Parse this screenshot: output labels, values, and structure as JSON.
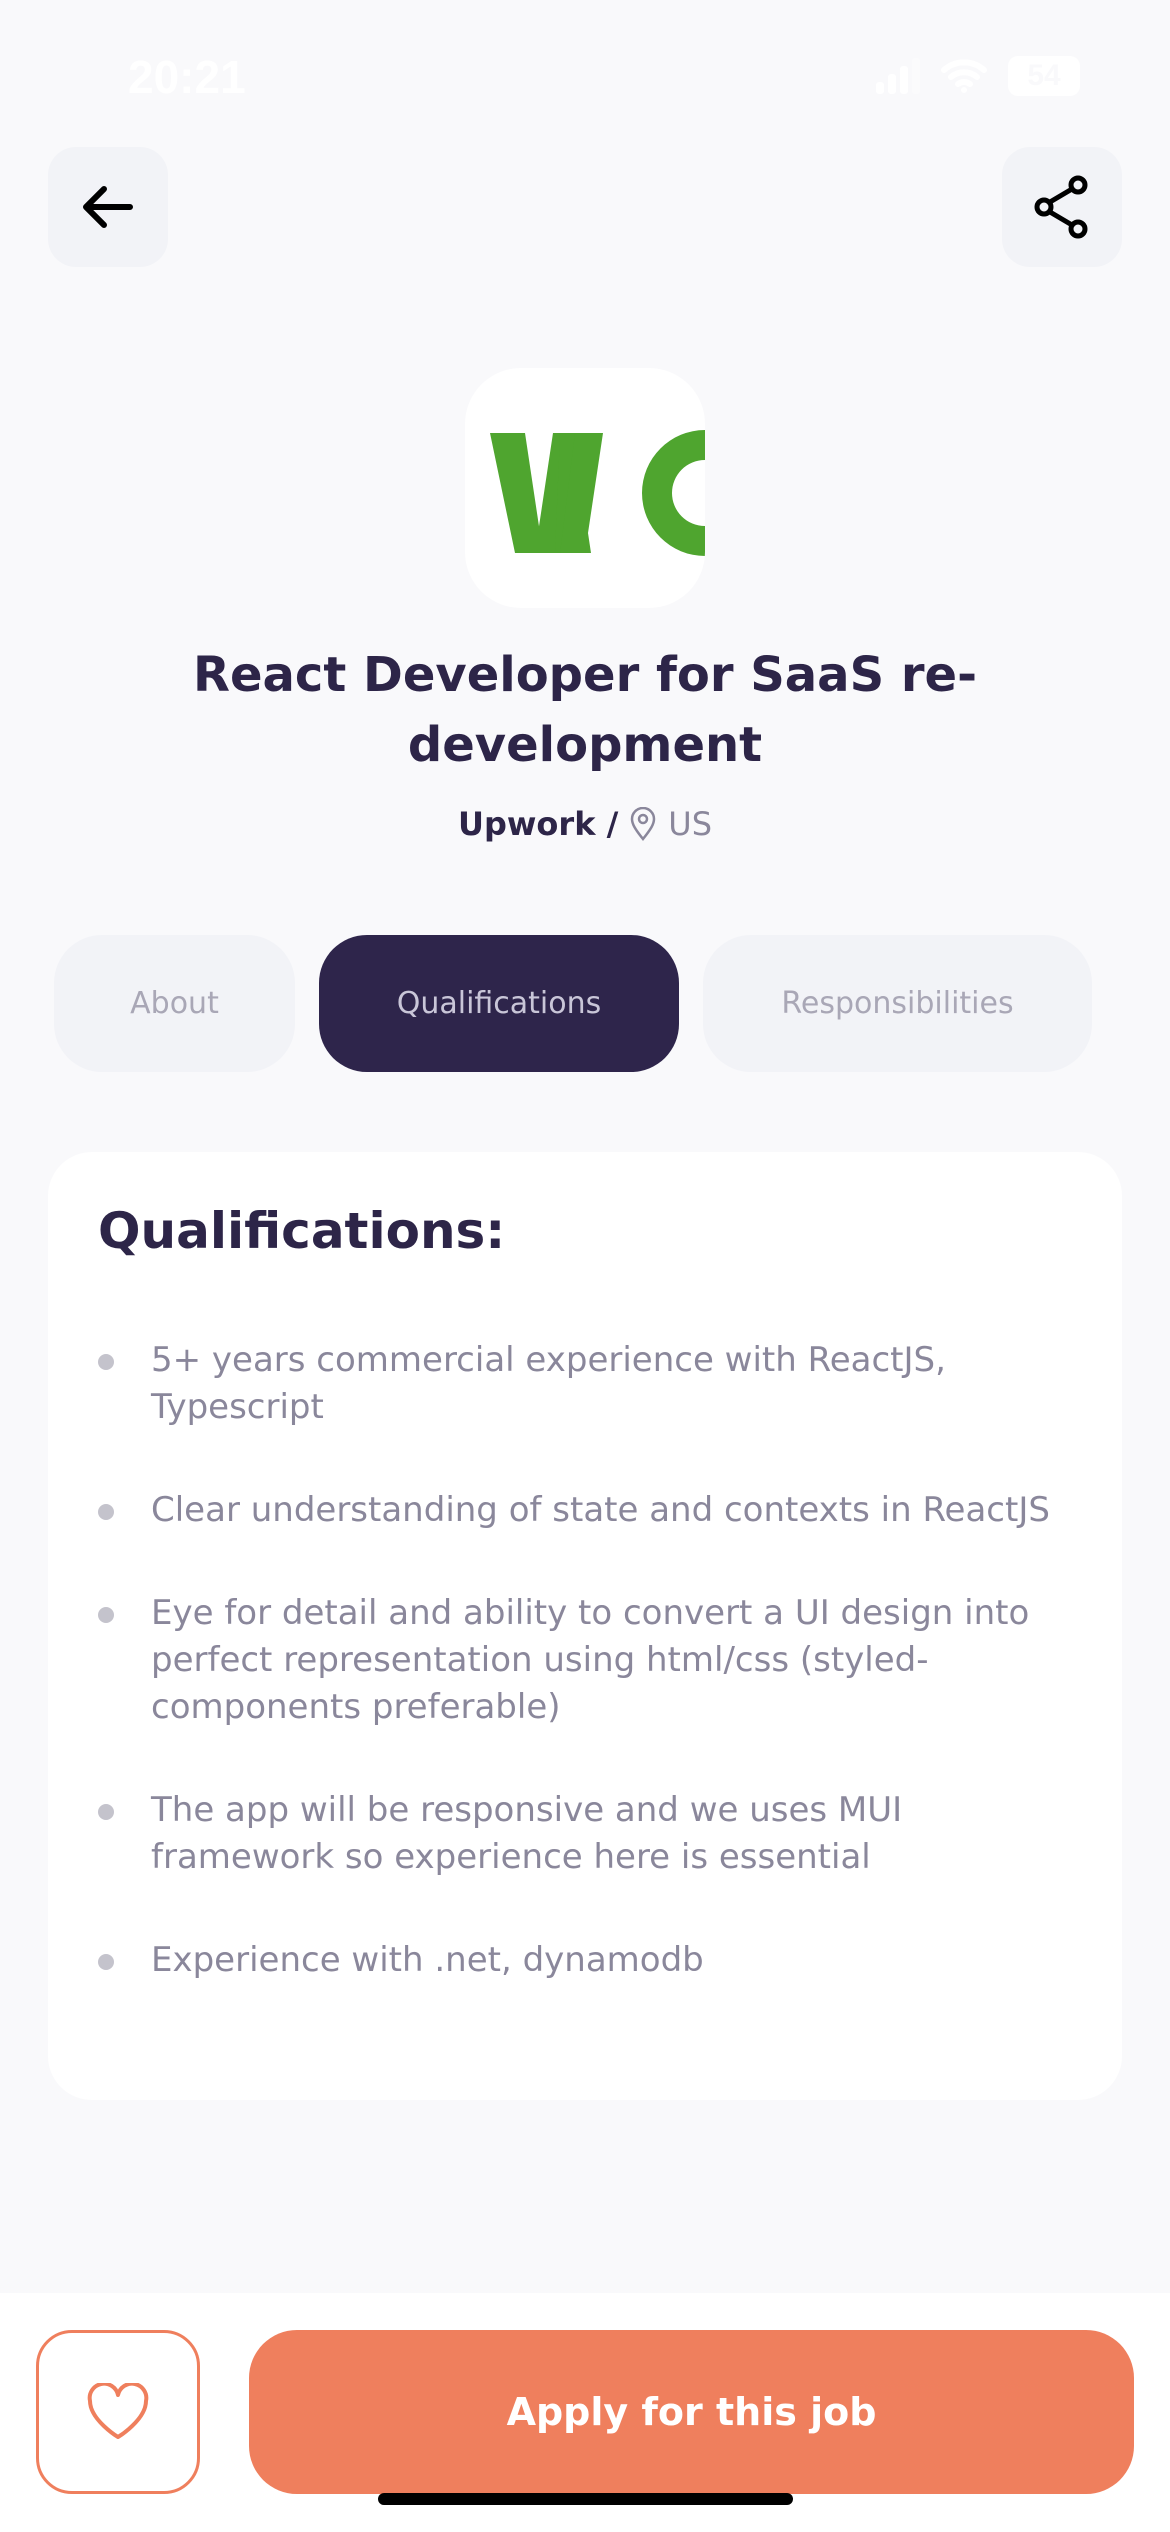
{
  "status_bar": {
    "time": "20:21",
    "battery": "54"
  },
  "header": {
    "back_icon": "arrow-left-icon",
    "share_icon": "share-icon"
  },
  "job": {
    "logo_text": "WC",
    "logo_color": "#4fa52f",
    "title": "React Developer for SaaS re-development",
    "company": "Upwork /",
    "location": "US"
  },
  "tabs": [
    {
      "label": "About",
      "active": false
    },
    {
      "label": "Qualifications",
      "active": true
    },
    {
      "label": "Responsibilities",
      "active": false
    }
  ],
  "qualifications": {
    "heading": "Qualifications:",
    "items": [
      "5+ years commercial experience with ReactJS, Typescript",
      "Clear understanding of state and contexts in ReactJS",
      "Eye for detail and ability to convert a UI design into perfect representation using html/css (styled-components preferable)",
      "The app will be responsive and we uses MUI framework so experience here is essential",
      "Experience with .net, dynamodb"
    ]
  },
  "footer": {
    "apply_label": "Apply for this job",
    "favorite_icon": "heart-icon",
    "accent": "#ef7f5d"
  }
}
